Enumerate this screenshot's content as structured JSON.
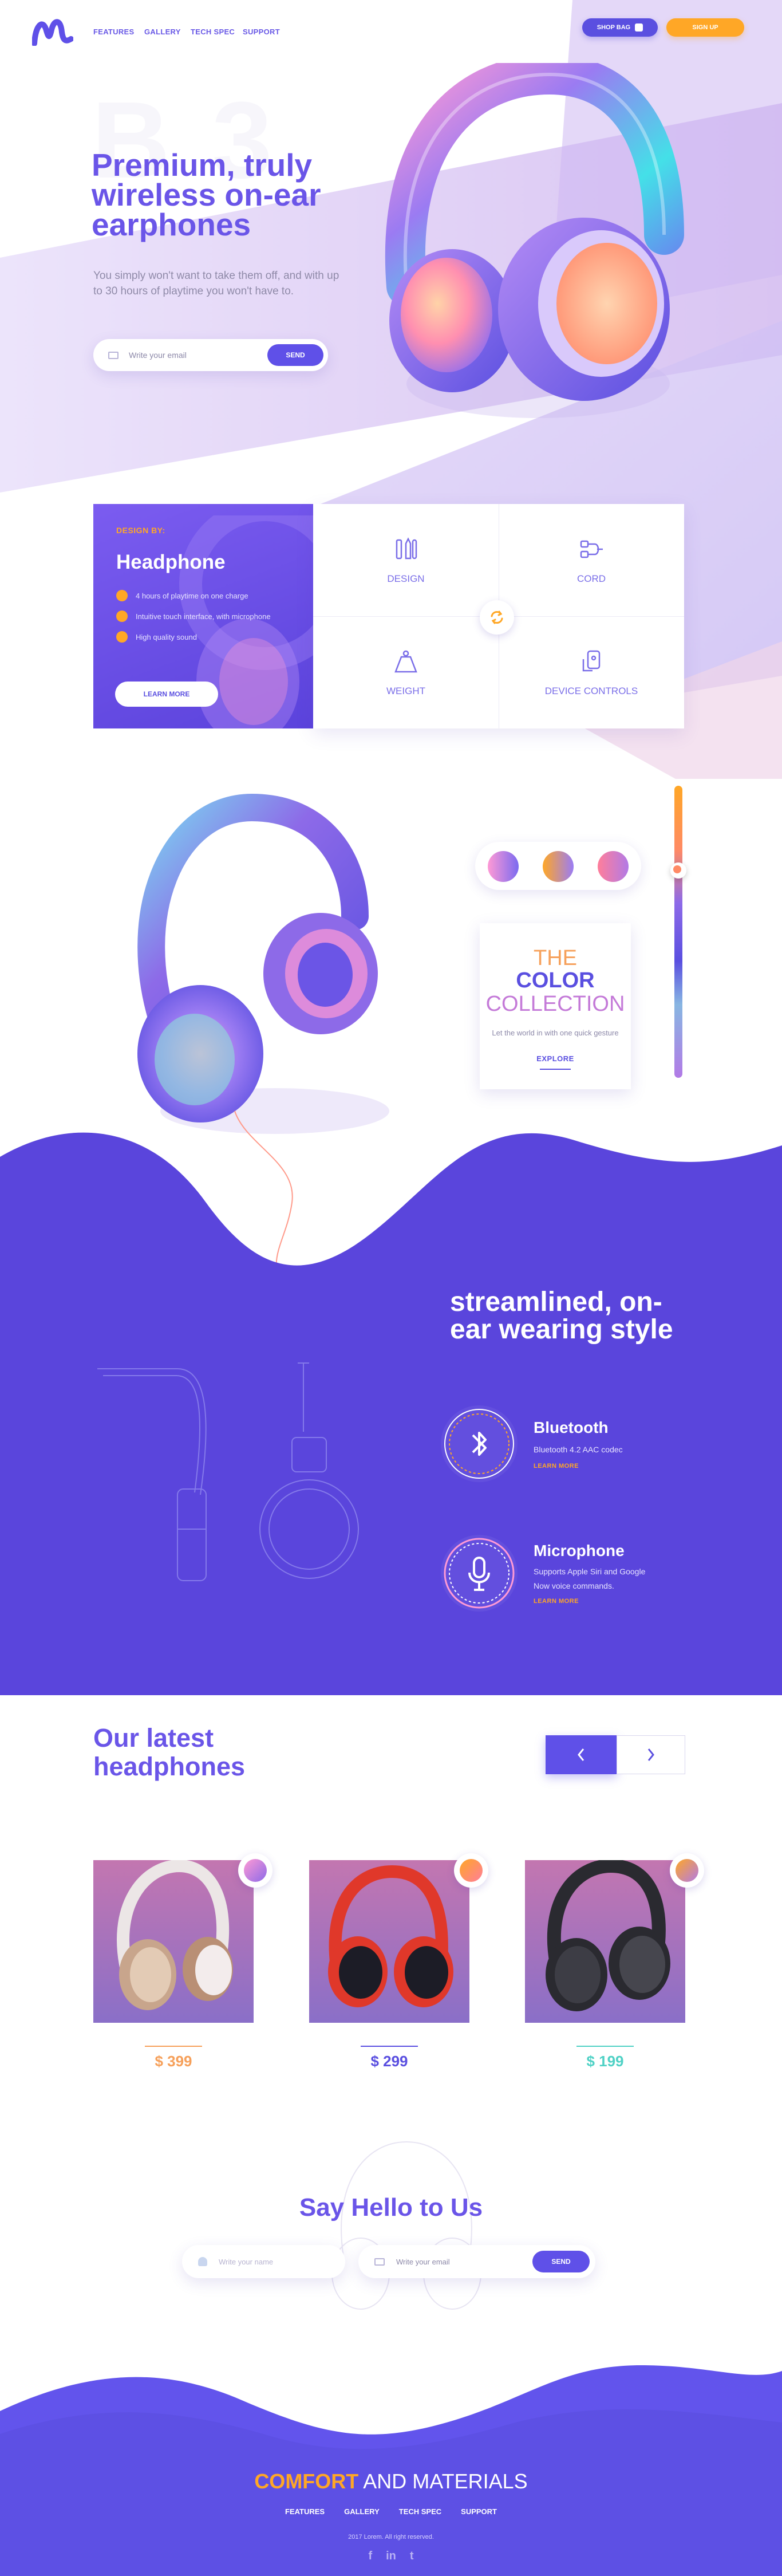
{
  "brand": {
    "logo_icon": "m-wave-logo-icon",
    "accent": "#5f50e8",
    "orange": "#ffa726",
    "dark_purple": "#5a45dc"
  },
  "nav": {
    "features": "FEATURES",
    "gallery": "GALLERY",
    "tech_spec": "TECH SPEC",
    "support": "SUPPORT"
  },
  "header": {
    "shop_bag": "SHOP BAG",
    "sign_up": "SIGN UP"
  },
  "hero": {
    "watermark": "B 3",
    "title": "Premium, truly wireless on-ear earphones",
    "subtitle": "You simply won't want to take them off, and with up to 30 hours of playtime you won't have to.",
    "email_placeholder": "Write your email",
    "send": "SEND"
  },
  "design_card": {
    "label": "DESIGN BY:",
    "name": "Headphone",
    "features": [
      "4 hours of playtime on one charge",
      "Intuitive touch interface, with microphone",
      "High quality sound"
    ],
    "learn_more": "LEARN MORE"
  },
  "feature_grid": [
    {
      "label": "DESIGN",
      "icon": "design-tools-icon"
    },
    {
      "label": "CORD",
      "icon": "cord-icon"
    },
    {
      "label": "WEIGHT",
      "icon": "weight-icon"
    },
    {
      "label": "DEVICE CONTROLS",
      "icon": "device-controls-icon"
    }
  ],
  "collection": {
    "line1": "THE",
    "line2": "COLOR",
    "line3": "COLLECTION",
    "text": "Let the world in with one quick gesture",
    "explore": "EXPLORE"
  },
  "streamlined": {
    "title": "streamlined, on-ear wearing style",
    "bluetooth": {
      "title": "Bluetooth",
      "desc": "Bluetooth 4.2 AAC codec",
      "link": "LEARN MORE"
    },
    "microphone": {
      "title": "Microphone",
      "desc_1": "Supports Apple Siri and Google",
      "desc_2": "Now  voice commands.",
      "link": "LEARN MORE"
    }
  },
  "latest": {
    "title": "Our latest headphones",
    "products": [
      {
        "price": "$ 399",
        "color": "#f6a05a"
      },
      {
        "price": "$ 299",
        "color": "#5a4fe0"
      },
      {
        "price": "$ 199",
        "color": "#4fd1c5"
      }
    ]
  },
  "contact": {
    "title": "Say Hello to Us",
    "name_placeholder": "Write your name",
    "email_placeholder": "Write your email",
    "send": "SEND"
  },
  "footer": {
    "comfort": "COMFORT",
    "and_materials": "AND  MATERIALS",
    "nav": [
      "FEATURES",
      "GALLERY",
      "TECH SPEC",
      "SUPPORT"
    ],
    "copyright": "2017 Lorem. All right reserved.",
    "social": [
      "facebook-icon",
      "linkedin-icon",
      "twitter-icon"
    ]
  }
}
